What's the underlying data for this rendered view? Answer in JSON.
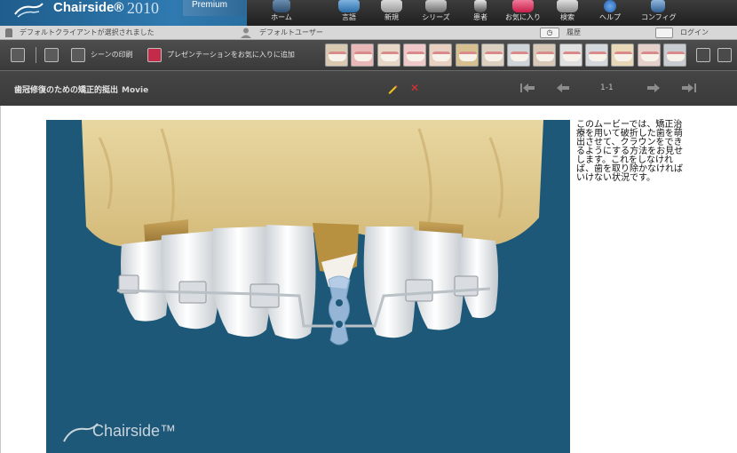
{
  "brand": {
    "name": "Chairside®",
    "year": "2010",
    "edition": "Premium"
  },
  "nav": [
    {
      "label": "ホーム",
      "icon": "home-chair-icon"
    },
    {
      "label": "言語",
      "icon": "language-icon"
    },
    {
      "label": "新規",
      "icon": "new-icon"
    },
    {
      "label": "シリーズ",
      "icon": "series-film-icon"
    },
    {
      "label": "患者",
      "icon": "patient-icon"
    },
    {
      "label": "お気に入り",
      "icon": "favorites-heart-icon"
    },
    {
      "label": "検索",
      "icon": "search-icon"
    },
    {
      "label": "ヘルプ",
      "icon": "help-icon"
    },
    {
      "label": "コンフィグ",
      "icon": "config-icon"
    }
  ],
  "status": {
    "client": "デフォルトクライアントが選択されました",
    "user": "デフォルトユーザー",
    "history": "履歴",
    "login": "ログイン"
  },
  "toolbar": {
    "print_scene": "シーンの印刷",
    "add_favorite": "プレゼンテーションをお気に入りに追加"
  },
  "scene": {
    "title": "歯冠修復のための矯正的挺出",
    "type": "Movie",
    "page": "1-1"
  },
  "player": {
    "watermark": "Chairside™"
  },
  "description": "このムービーでは、矯正治療を用いて破折した歯を萌出させて、クラウンをできるようにする方法をお見せします。これをしなければ、歯を取り除かなければいけない状況です。",
  "colors": {
    "brand_blue": "#2f7ab0",
    "player_background": "#1e5878",
    "delete_red": "#e53030",
    "edit_yellow": "#f0c419"
  }
}
